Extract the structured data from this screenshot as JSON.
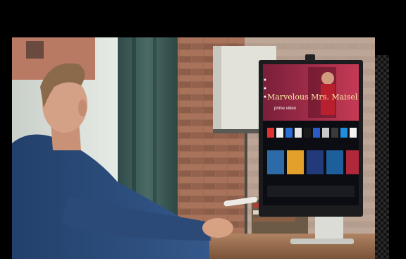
{
  "scene": {
    "subject": "man-with-remote-and-monitor"
  },
  "monitor": {
    "hero_title": "Marvelous Mrs. Maisel",
    "hero_brand": "prime video",
    "icons": [
      "search-icon",
      "home-icon",
      "apps-icon"
    ]
  },
  "colors": {
    "background": "#000000",
    "shirt": "#2b4a78",
    "wall_brick": "#8a5a45",
    "monitor_bezel": "#1c1c1e",
    "accent_red": "#b0283a"
  }
}
